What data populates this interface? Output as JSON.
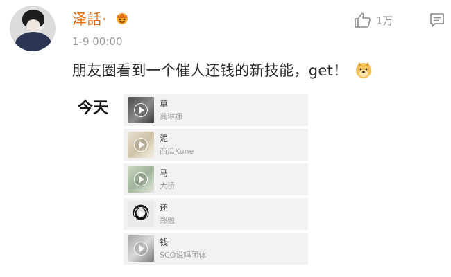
{
  "user": {
    "name": "泽話·",
    "timestamp": "1-9 00:00"
  },
  "actions": {
    "like_count": "1万"
  },
  "post": {
    "text": "朋友圈看到一个催人还钱的新技能，get！"
  },
  "today_label": "今天",
  "songs": [
    {
      "title": "草",
      "artist": "龚琳娜"
    },
    {
      "title": "泥",
      "artist": "西瓜Kune"
    },
    {
      "title": "马",
      "artist": "大桥"
    },
    {
      "title": "还",
      "artist": "郑融"
    },
    {
      "title": "钱",
      "artist": "SCO说唱团体"
    }
  ],
  "colors": {
    "username": "#e56e12",
    "badge": "#f5a623",
    "card_background": "#f2f2f2"
  },
  "icons": {
    "badge": "crown-smiley-icon",
    "like": "thumbs-up-icon",
    "comment": "comment-icon",
    "emoji": "doge-icon"
  }
}
